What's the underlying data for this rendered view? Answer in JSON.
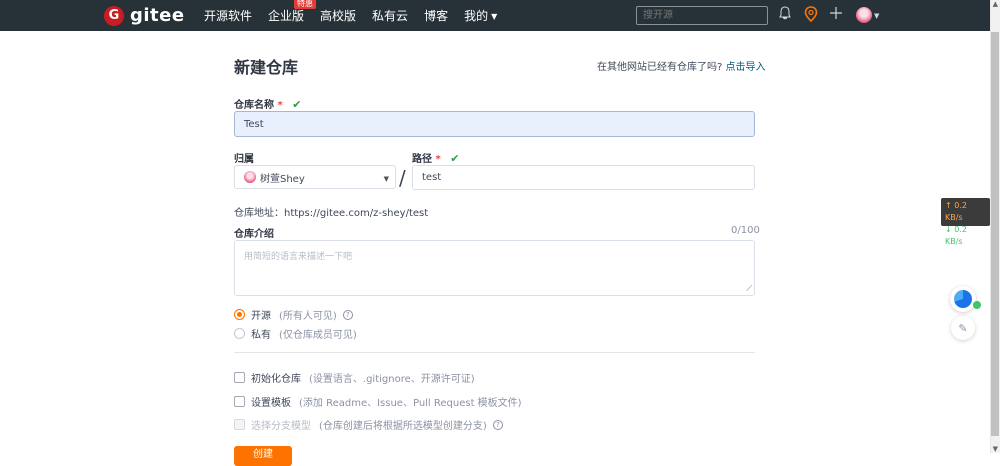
{
  "header": {
    "logo_mark": "G",
    "logo_text": "gitee",
    "nav": [
      {
        "label": "开源软件"
      },
      {
        "label": "企业版",
        "badge": "特惠"
      },
      {
        "label": "高校版"
      },
      {
        "label": "私有云"
      },
      {
        "label": "博客"
      },
      {
        "label": "我的"
      }
    ],
    "search_placeholder": "搜开源",
    "icons": [
      "bell-icon",
      "map-pin-icon",
      "plus-icon",
      "avatar"
    ]
  },
  "form": {
    "title": "新建仓库",
    "import_question": "在其他网站已经有仓库了吗?",
    "import_link": "点击导入",
    "repo_name_label": "仓库名称",
    "required_mark": "*",
    "repo_name_value": "Test",
    "owner_label": "归属",
    "owner_value": "树萱Shey",
    "path_label": "路径",
    "path_value": "test",
    "path_separator": "/",
    "address": "仓库地址：https://gitee.com/z-shey/test",
    "intro_label": "仓库介绍",
    "intro_counter": "0/100",
    "intro_placeholder": "用简短的语言来描述一下吧",
    "visibility": [
      {
        "label": "开源",
        "hint": "(所有人可见)",
        "selected": true,
        "help": "?"
      },
      {
        "label": "私有",
        "hint": "(仅仓库成员可见)",
        "selected": false
      }
    ],
    "options": [
      {
        "label": "初始化仓库",
        "hint": "(设置语言、.gitignore、开源许可证)",
        "disabled": false
      },
      {
        "label": "设置模板",
        "hint": "(添加 Readme、Issue、Pull Request 模板文件)",
        "disabled": false
      },
      {
        "label": "选择分支模型",
        "hint": "(仓库创建后将根据所选模型创建分支)",
        "disabled": true,
        "help": "?"
      }
    ],
    "create_button": "创建"
  },
  "speed_widget": {
    "up": "↑ 0.2 KB/s",
    "down": "↓ 0.2 KB/s"
  },
  "colors": {
    "header_bg": "#263238",
    "accent": "#fe7300",
    "valid": "#2c9d44",
    "link": "#005980"
  }
}
